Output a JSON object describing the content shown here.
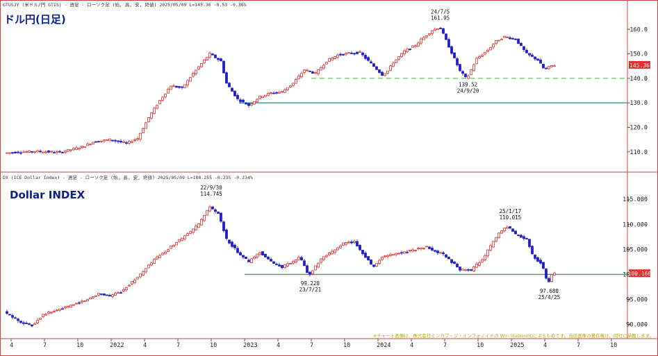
{
  "window": {
    "background": "#ffffff",
    "panel_border": "#d04040"
  },
  "top_panel": {
    "header": "GTUSJY (米ドル/円 GTIS) - 週足 - ローソク足 (始, 高, 安, 終値)  2025/05/09 L=145.36 -0.53  -0.36%",
    "title": "ドル円(日足)"
  },
  "bottom_panel": {
    "header": "DX (ICE Dollar Index) - 週足 - ローソク足 (始, 高, 安, 終値)  2025/05/09 L=100.255 -0.235  -0.234%",
    "title": "Dollar INDEX"
  },
  "notice": "※チャート画像は、株式会社ミンカブ・ジ・インフォノイドの Win-Station(R)によるものです。当該画像の著作権は、同社に帰属します。",
  "x_axis": {
    "labels": [
      {
        "t": 0.5,
        "text": "4"
      },
      {
        "t": 3.5,
        "text": "7"
      },
      {
        "t": 6.5,
        "text": "10"
      },
      {
        "t": 9.5,
        "text": "2022"
      },
      {
        "t": 12.5,
        "text": "4"
      },
      {
        "t": 15.5,
        "text": "7"
      },
      {
        "t": 18.5,
        "text": "10"
      },
      {
        "t": 21.5,
        "text": "2023"
      },
      {
        "t": 24.5,
        "text": "4"
      },
      {
        "t": 27.5,
        "text": "7"
      },
      {
        "t": 30.5,
        "text": "10"
      },
      {
        "t": 33.5,
        "text": "2024"
      },
      {
        "t": 36.5,
        "text": "4"
      },
      {
        "t": 39.5,
        "text": "7"
      },
      {
        "t": 42.5,
        "text": "10"
      },
      {
        "t": 45.5,
        "text": "2025"
      },
      {
        "t": 48.5,
        "text": "4"
      },
      {
        "t": 51.5,
        "text": "7"
      },
      {
        "t": 54.5,
        "text": "10"
      }
    ]
  },
  "chart_data": [
    {
      "type": "candlestick",
      "title": "ドル円(日足)",
      "unit_x": "month (0 = 2021/03)",
      "ylim": [
        104,
        168
      ],
      "y_ticks": [
        110,
        120,
        130,
        140,
        150,
        160
      ],
      "up_color": "#e03030",
      "down_color": "#2020c8",
      "last_value": "145.36",
      "last_color": "#e03030",
      "reference_lines": [
        {
          "value": 140.0,
          "style": "dashed",
          "color": "#66c066"
        },
        {
          "value": 130.0,
          "style": "solid",
          "color": "#2e9e6e"
        }
      ],
      "annotations": [
        {
          "date": "24/7/5",
          "value": "161.95",
          "t": 39.1,
          "y": 161.95,
          "position": "above"
        },
        {
          "date": "24/9/20",
          "value": "139.52",
          "t": 41.6,
          "y": 139.52,
          "position": "below"
        }
      ],
      "anchors": [
        [
          0.0,
          109.5
        ],
        [
          1.5,
          110.0
        ],
        [
          3.0,
          110.2
        ],
        [
          5.0,
          109.8
        ],
        [
          7.0,
          112.0
        ],
        [
          8.0,
          114.0
        ],
        [
          9.5,
          115.0
        ],
        [
          11.0,
          113.5
        ],
        [
          12.0,
          115.5
        ],
        [
          13.0,
          124.0
        ],
        [
          14.0,
          131.0
        ],
        [
          15.0,
          137.0
        ],
        [
          16.0,
          136.0
        ],
        [
          17.0,
          142.0
        ],
        [
          18.5,
          150.0
        ],
        [
          19.5,
          147.0
        ],
        [
          20.0,
          138.0
        ],
        [
          21.0,
          131.5
        ],
        [
          22.0,
          129.0
        ],
        [
          23.0,
          132.5
        ],
        [
          24.0,
          134.0
        ],
        [
          25.0,
          134.5
        ],
        [
          26.0,
          138.0
        ],
        [
          27.0,
          143.5
        ],
        [
          28.0,
          142.0
        ],
        [
          29.0,
          147.0
        ],
        [
          30.0,
          149.5
        ],
        [
          31.0,
          150.2
        ],
        [
          32.0,
          150.5
        ],
        [
          33.0,
          146.0
        ],
        [
          34.0,
          141.5
        ],
        [
          34.5,
          143.0
        ],
        [
          35.0,
          146.5
        ],
        [
          36.0,
          151.0
        ],
        [
          37.0,
          153.5
        ],
        [
          37.5,
          155.8
        ],
        [
          38.5,
          159.5
        ],
        [
          39.2,
          161.0
        ],
        [
          40.0,
          153.0
        ],
        [
          41.0,
          143.0
        ],
        [
          41.6,
          139.8
        ],
        [
          42.5,
          148.0
        ],
        [
          43.5,
          151.5
        ],
        [
          44.2,
          155.0
        ],
        [
          45.0,
          157.0
        ],
        [
          46.0,
          156.0
        ],
        [
          47.0,
          150.0
        ],
        [
          48.0,
          147.5
        ],
        [
          48.6,
          143.5
        ],
        [
          49.3,
          145.3
        ]
      ]
    },
    {
      "type": "candlestick",
      "title": "Dollar INDEX",
      "unit_x": "month (0 = 2021/03)",
      "ylim": [
        88,
        118.5
      ],
      "y_ticks": [
        90.0,
        95.0,
        100.0,
        105.0,
        110.0,
        115.0
      ],
      "up_color": "#e03030",
      "down_color": "#2020c8",
      "last_value": "100.166",
      "last_color": "#e03030",
      "reference_lines": [
        {
          "value": 100.0,
          "style": "solid",
          "color": "#2e9e6e"
        }
      ],
      "annotations": [
        {
          "date": "22/9/30",
          "value": "114.745",
          "t": 18.5,
          "y": 114.745,
          "position": "above"
        },
        {
          "date": "23/7/21",
          "value": "99.220",
          "t": 27.4,
          "y": 99.22,
          "position": "below"
        },
        {
          "date": "25/1/17",
          "value": "110.015",
          "t": 45.4,
          "y": 110.015,
          "position": "above"
        },
        {
          "date": "25/4/25",
          "value": "97.680",
          "t": 48.9,
          "y": 97.68,
          "position": "below"
        }
      ],
      "anchors": [
        [
          0.0,
          92.5
        ],
        [
          1.5,
          90.5
        ],
        [
          2.5,
          89.8
        ],
        [
          3.5,
          92.0
        ],
        [
          5.0,
          93.0
        ],
        [
          6.0,
          93.8
        ],
        [
          7.5,
          95.0
        ],
        [
          8.5,
          96.2
        ],
        [
          9.5,
          95.7
        ],
        [
          10.5,
          96.5
        ],
        [
          11.5,
          98.5
        ],
        [
          12.5,
          100.5
        ],
        [
          13.5,
          103.0
        ],
        [
          14.5,
          104.5
        ],
        [
          15.5,
          106.5
        ],
        [
          16.5,
          108.0
        ],
        [
          17.5,
          110.0
        ],
        [
          18.5,
          113.5
        ],
        [
          19.3,
          112.0
        ],
        [
          20.0,
          107.0
        ],
        [
          21.0,
          104.5
        ],
        [
          22.0,
          102.5
        ],
        [
          23.0,
          104.5
        ],
        [
          24.0,
          102.5
        ],
        [
          25.0,
          101.5
        ],
        [
          26.0,
          102.5
        ],
        [
          26.6,
          103.5
        ],
        [
          27.4,
          99.8
        ],
        [
          28.5,
          103.0
        ],
        [
          29.5,
          104.5
        ],
        [
          30.5,
          106.2
        ],
        [
          31.5,
          106.5
        ],
        [
          32.5,
          103.5
        ],
        [
          33.2,
          101.5
        ],
        [
          34.0,
          103.5
        ],
        [
          35.0,
          104.0
        ],
        [
          36.0,
          104.5
        ],
        [
          37.0,
          105.0
        ],
        [
          38.0,
          105.5
        ],
        [
          38.8,
          104.5
        ],
        [
          39.5,
          104.0
        ],
        [
          40.5,
          102.0
        ],
        [
          41.0,
          101.0
        ],
        [
          42.0,
          100.8
        ],
        [
          43.0,
          103.0
        ],
        [
          44.0,
          106.5
        ],
        [
          44.6,
          108.5
        ],
        [
          45.3,
          109.5
        ],
        [
          46.0,
          108.0
        ],
        [
          47.0,
          107.0
        ],
        [
          47.6,
          103.5
        ],
        [
          48.4,
          102.0
        ],
        [
          48.9,
          98.0
        ],
        [
          49.3,
          100.2
        ]
      ]
    }
  ]
}
